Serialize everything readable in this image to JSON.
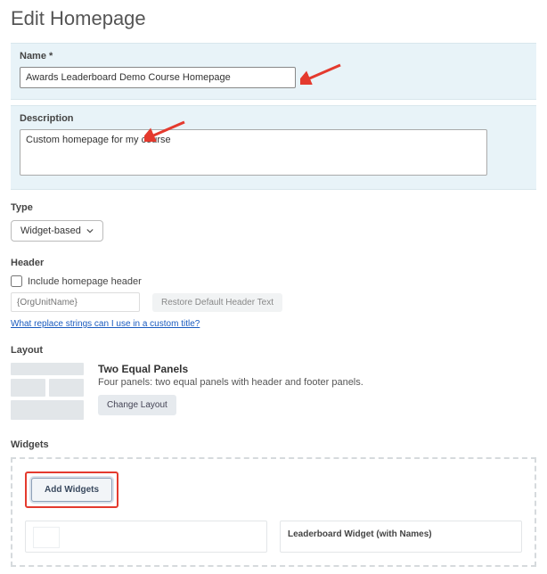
{
  "page_title": "Edit Homepage",
  "name_section": {
    "label": "Name *",
    "value": "Awards Leaderboard Demo Course Homepage"
  },
  "description_section": {
    "label": "Description",
    "value": "Custom homepage for my course"
  },
  "type_section": {
    "label": "Type",
    "selected": "Widget-based"
  },
  "header_section": {
    "label": "Header",
    "checkbox_label": "Include homepage header",
    "placeholder": "{OrgUnitName}",
    "restore_btn": "Restore Default Header Text",
    "help_link": "What replace strings can I use in a custom title?"
  },
  "layout_section": {
    "label": "Layout",
    "name": "Two Equal Panels",
    "desc": "Four panels: two equal panels with header and footer panels.",
    "change_btn": "Change Layout"
  },
  "widgets_section": {
    "label": "Widgets",
    "add_btn": "Add Widgets",
    "right_widget": "Leaderboard Widget (with Names)"
  }
}
